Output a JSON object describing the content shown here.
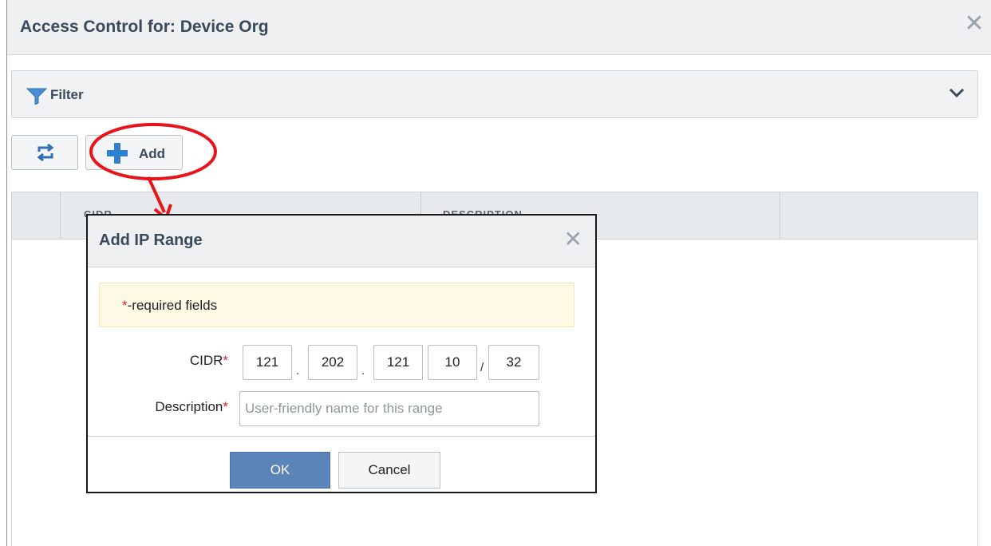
{
  "window": {
    "title": "Access Control for: Device Org",
    "close_icon": "close-icon"
  },
  "filter": {
    "label": "Filter",
    "icon": "funnel-icon",
    "toggle_icon": "chevron-down-icon"
  },
  "toolbar": {
    "refresh_icon": "refresh-icon",
    "add_icon": "plus-icon",
    "add_label": "Add"
  },
  "table": {
    "columns": [
      "CIDR",
      "DESCRIPTION"
    ]
  },
  "dialog": {
    "title": "Add IP Range",
    "close_icon": "close-icon",
    "required_asterisk": "*",
    "required_note": "-required fields",
    "cidr_label": "CIDR",
    "cidr_octets": [
      "121",
      "202",
      "121",
      "10"
    ],
    "cidr_dot": ".",
    "cidr_slash": "/",
    "cidr_prefix": "32",
    "description_label": "Description",
    "description_placeholder": "User-friendly name for this range",
    "ok_label": "OK",
    "cancel_label": "Cancel"
  },
  "colors": {
    "annotation": "#e8141b",
    "primary_button": "#5b84b8",
    "required": "#d0262a",
    "notice_bg": "#fdf9e4"
  }
}
